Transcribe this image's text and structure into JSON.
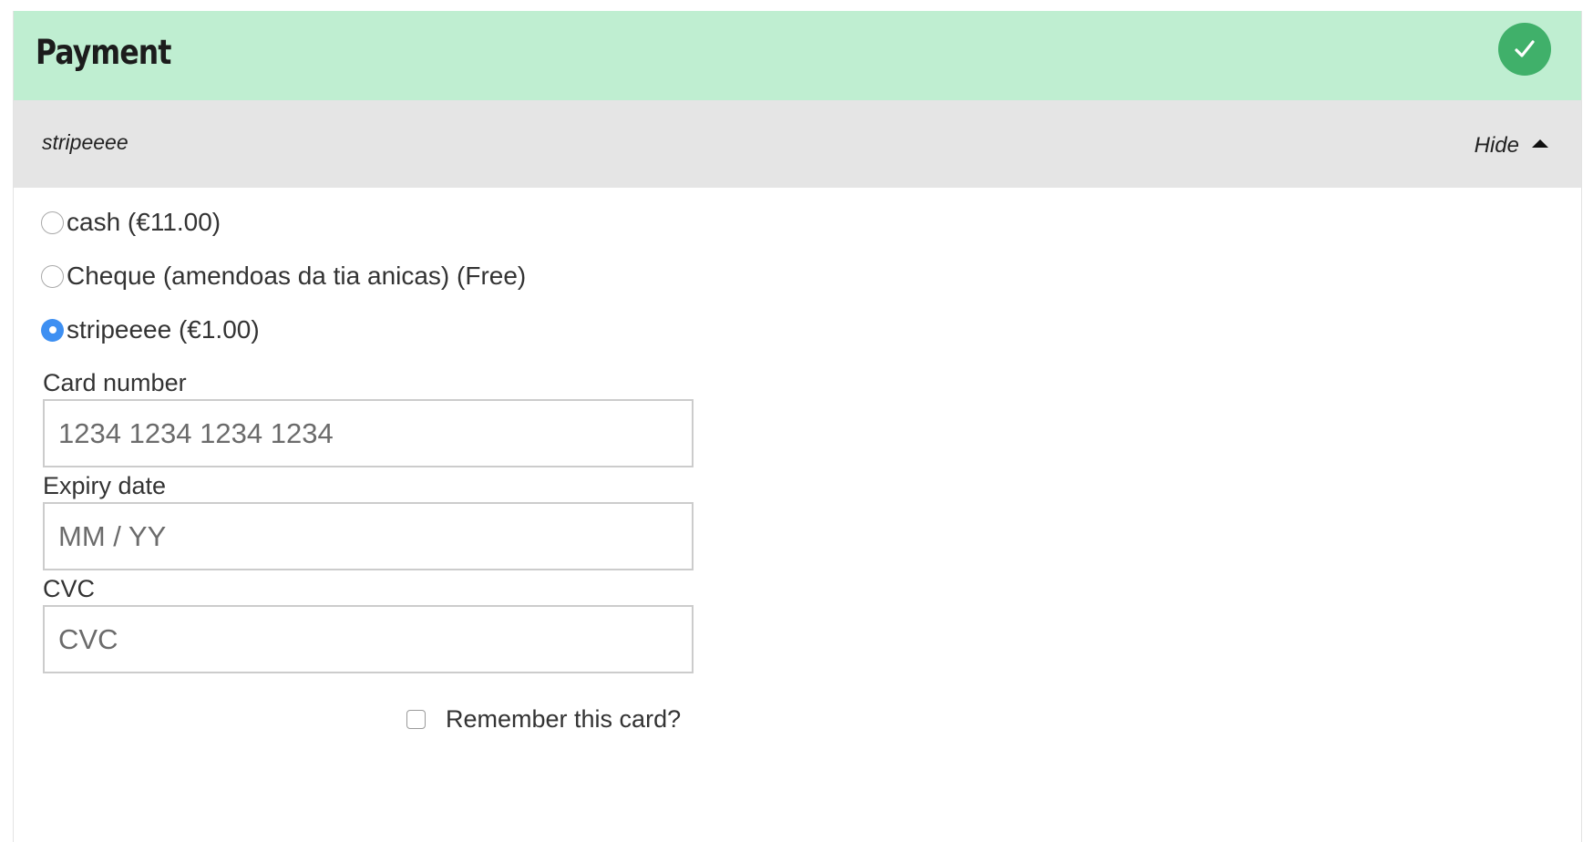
{
  "header": {
    "title": "Payment",
    "status_icon": "check-circle-icon",
    "status_color": "#40b06a",
    "background": "#bfeed1"
  },
  "summary": {
    "selected_method": "stripeeee",
    "toggle_label": "Hide",
    "toggle_icon": "caret-up-icon"
  },
  "payment_options": [
    {
      "label": "cash (€11.00)",
      "selected": false
    },
    {
      "label": "Cheque (amendoas da tia anicas) (Free)",
      "selected": false
    },
    {
      "label": "stripeeee (€1.00)",
      "selected": true
    }
  ],
  "card_form": {
    "card_number": {
      "label": "Card number",
      "placeholder": "1234 1234 1234 1234",
      "value": ""
    },
    "expiry": {
      "label": "Expiry date",
      "placeholder": "MM / YY",
      "value": ""
    },
    "cvc": {
      "label": "CVC",
      "placeholder": "CVC",
      "value": ""
    },
    "remember": {
      "label": "Remember this card?",
      "checked": false
    }
  }
}
